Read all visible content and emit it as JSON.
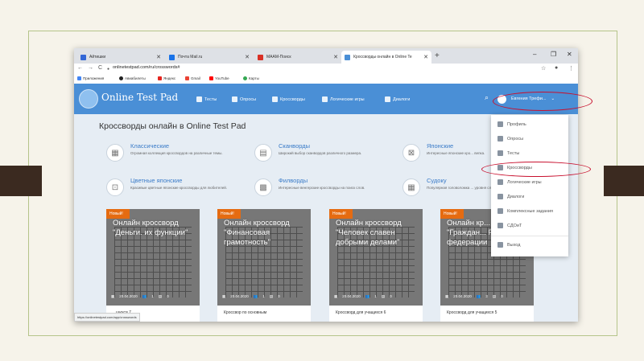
{
  "browser": {
    "tabs": [
      {
        "label": "Айтишки",
        "color": "#3367d6"
      },
      {
        "label": "Почта Mail.ru",
        "color": "#1a73e8"
      },
      {
        "label": "МААМ-Поиск",
        "color": "#d93025"
      },
      {
        "label": "Кроссворды онлайн в Online Te",
        "color": "#4a8fd6"
      }
    ],
    "url": "onlinetestpad.com/ru/crosswords#",
    "bookmarks": [
      "Приложения",
      "Авиабилеты",
      "Яндекс",
      "Gmail",
      "YouTube",
      "Карты"
    ],
    "status_url": "https://onlinetestpad.com/app/crosswords"
  },
  "header": {
    "logo": "Online Test Pad",
    "menu": [
      "Тесты",
      "Опросы",
      "Кроссворды",
      "Логические игры",
      "Диалоги"
    ],
    "user": "Евгения Трефи..."
  },
  "page": {
    "title": "Кроссворды онлайн в Online Test Pad",
    "categories": [
      {
        "title": "Классические",
        "desc": "Огромная коллекция кроссвордов на различные темы."
      },
      {
        "title": "Сканворды",
        "desc": "Широкий выбор сканвордов различного размера."
      },
      {
        "title": "Японские",
        "desc": "Интересные японские кро... вепка."
      },
      {
        "title": "Цветные японские",
        "desc": "Красивые цветные японские кроссворды для любителей."
      },
      {
        "title": "Филворды",
        "desc": "Интересные венгерские кроссворды на поиск слов."
      },
      {
        "title": "Судоку",
        "desc": "Популярная головоломка ... уровня сложности."
      }
    ],
    "badge": "Новый!",
    "cards": [
      {
        "title": "Онлайн кроссворд \"Деньги. их функции\"",
        "date": "20.04.2020",
        "users": "1",
        "comments": "0",
        "footer": "...щихся 7"
      },
      {
        "title": "Онлайн кроссворд \"Финансовая грамотность\"",
        "date": "20.04.2020",
        "users": "1",
        "comments": "0",
        "footer": "Кроссвор по основным"
      },
      {
        "title": "Онлайн кроссворд \"Человек славен добрыми делами\"",
        "date": "20.04.2020",
        "users": "1",
        "comments": "0",
        "footer": "Кроссворд для учащихся 6"
      },
      {
        "title": "Онлайн кр... \"Граждан... Российск... федерации",
        "date": "20.04.2020",
        "users": "3",
        "comments": "0",
        "footer": "Кроссворд для учащихся 5"
      }
    ]
  },
  "dropdown": {
    "items": [
      "Профиль",
      "Опросы",
      "Тесты",
      "Кроссворды",
      "Логические игры",
      "Диалоги",
      "Комплексные задания",
      "СДОиТ",
      "Выход"
    ]
  }
}
